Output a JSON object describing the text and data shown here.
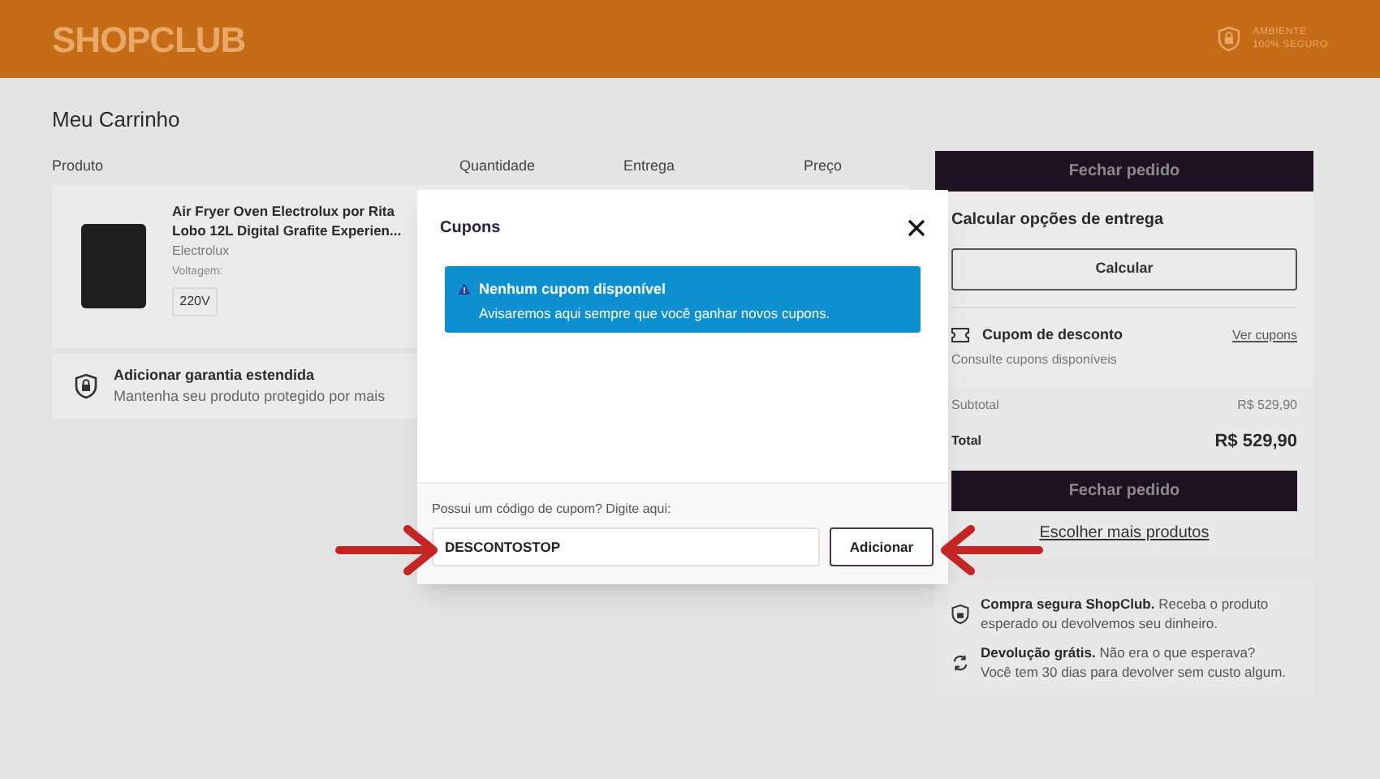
{
  "header": {
    "logo": "SHOPCLUB",
    "security_badge": [
      "AMBIENTE",
      "100% SEGURO"
    ]
  },
  "page_title": "Meu Carrinho",
  "cart_columns": [
    "Produto",
    "Quantidade",
    "Entrega",
    "Preço"
  ],
  "product": {
    "name": "Air Fryer Oven Electrolux por Rita Lobo 12L Digital Grafite Experien...",
    "brand": "Electrolux",
    "option_label": "Voltagem:",
    "option_value": "220V"
  },
  "warranty": {
    "title": "Adicionar garantia estendida",
    "description": "Mantenha seu produto protegido por mais"
  },
  "summary": {
    "checkout_top": "Fechar pedido",
    "delivery_title": "Calcular opções de entrega",
    "calculate_button": "Calcular",
    "coupon_title": "Cupom de desconto",
    "coupon_link": "Ver cupons",
    "coupon_hint": "Consulte cupons disponíveis",
    "subtotal_label": "Subtotal",
    "subtotal_value": "R$ 529,90",
    "total_label": "Total",
    "total_value": "R$ 529,90",
    "checkout_bottom": "Fechar pedido",
    "more_products": "Escolher mais produtos"
  },
  "guarantees": [
    {
      "kind": "lock",
      "bold": "Compra segura ShopClub.",
      "text": "Receba o produto esperado ou devolvemos seu dinheiro."
    },
    {
      "kind": "return",
      "bold": "Devolução grátis.",
      "text": "Não era o que esperava? Você tem 30 dias para devolver sem custo algum."
    }
  ],
  "modal": {
    "title": "Cupons",
    "alert_title": "Nenhum cupom disponível",
    "alert_text": "Avisaremos aqui sempre que você ganhar novos cupons.",
    "code_label": "Possui um código de cupom? Digite aqui:",
    "code_value": "DESCONTOSTOP",
    "add_button": "Adicionar"
  }
}
